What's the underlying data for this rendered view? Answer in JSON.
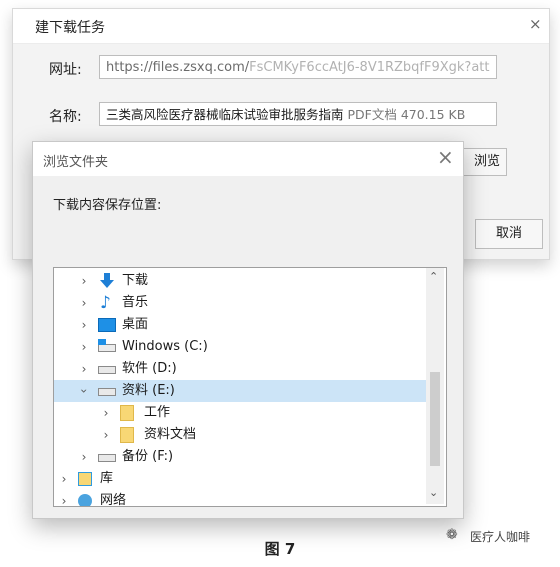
{
  "download_dialog": {
    "title": "建下载任务",
    "url_label": "网址:",
    "url_domain": "https://files.zsxq.com/",
    "url_path": "FsCMKyF6ccAtJ6-8V1RZbqfF9Xgk?att",
    "name_label": "名称:",
    "file_name": "三类高风险医疗器械临床试验审批服务指南",
    "file_meta": "PDF文档 470.15 KB",
    "browse_button": "浏览",
    "cancel_button": "取消",
    "close": "×"
  },
  "browse_dialog": {
    "title": "浏览文件夹",
    "close": "×",
    "prompt": "下载内容保存位置:",
    "tree": [
      {
        "label": "下载",
        "icon": "download-arrow-icon",
        "expanded": false,
        "selected": false
      },
      {
        "label": "音乐",
        "icon": "music-note-icon",
        "expanded": false,
        "selected": false
      },
      {
        "label": "桌面",
        "icon": "desktop-icon",
        "expanded": false,
        "selected": false
      },
      {
        "label": "Windows (C:)",
        "icon": "system-drive-icon",
        "expanded": false,
        "selected": false
      },
      {
        "label": "软件 (D:)",
        "icon": "drive-icon",
        "expanded": false,
        "selected": false
      },
      {
        "label": "资料 (E:)",
        "icon": "drive-icon",
        "expanded": true,
        "selected": true
      },
      {
        "label": "工作",
        "icon": "folder-icon",
        "expanded": false,
        "selected": false
      },
      {
        "label": "资料文档",
        "icon": "folder-icon",
        "expanded": false,
        "selected": false
      },
      {
        "label": "备份 (F:)",
        "icon": "drive-icon",
        "expanded": false,
        "selected": false
      },
      {
        "label": "库",
        "icon": "library-icon",
        "expanded": false,
        "selected": false
      },
      {
        "label": "网络",
        "icon": "network-icon",
        "expanded": false,
        "selected": false
      }
    ]
  },
  "caption": "图 7",
  "watermark": "医疗人咖啡",
  "colors": {
    "selection": "#cce4f7",
    "download_arrow": "#1e7fd6",
    "music_note": "#1e7fd6",
    "folder": "#f8d775"
  }
}
